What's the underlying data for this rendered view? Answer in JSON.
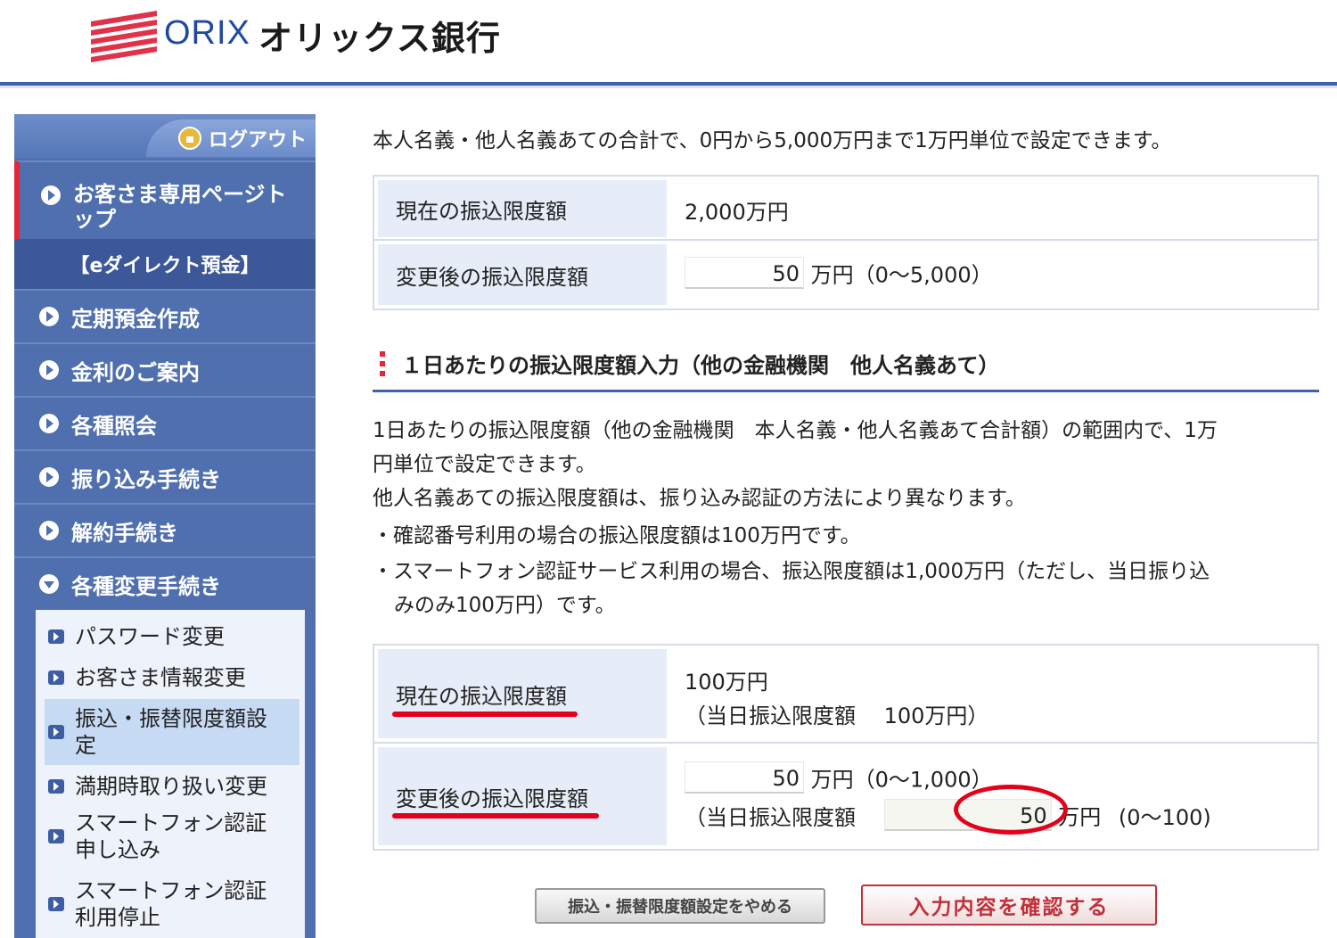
{
  "header": {
    "logo_orix": "ORIX",
    "logo_jp": "オリックス銀行"
  },
  "sidebar": {
    "logout": "ログアウト",
    "top_item": "お客さま専用ページトップ",
    "section_label": "【eダイレクト預金】",
    "items": [
      "定期預金作成",
      "金利のご案内",
      "各種照会",
      "振り込み手続き",
      "解約手続き",
      "各種変更手続き"
    ],
    "sub_items": [
      "パスワード変更",
      "お客さま情報変更",
      "振込・振替限度額設定",
      "満期時取り扱い変更",
      "スマートフォン認証申し込み",
      "スマートフォン認証利用停止"
    ]
  },
  "main": {
    "intro": "本人名義・他人名義あての合計で、0円から5,000万円まで1万円単位で設定できます。",
    "table1": {
      "current_label": "現在の振込限度額",
      "current_value": "2,000万円",
      "new_label": "変更後の振込限度額",
      "new_input": "50",
      "new_unit": "万円（0〜5,000）"
    },
    "section_title": "１日あたりの振込限度額入力（他の金融機関　他人名義あて）",
    "para1_line1": "1日あたりの振込限度額（他の金融機関　本人名義・他人名義あて合計額）の範囲内で、1万",
    "para1_line2": "円単位で設定できます。",
    "para2": "他人名義あての振込限度額は、振り込み認証の方法により異なります。",
    "bullet1": "・確認番号利用の場合の振込限度額は100万円です。",
    "bullet2_line1": "・スマートフォン認証サービス利用の場合、振込限度額は1,000万円（ただし、当日振り込",
    "bullet2_line2": "みのみ100万円）です。",
    "table2": {
      "current_label": "現在の振込限度額",
      "current_value_line1": "100万円",
      "current_value_line2": "（当日振込限度額　 100万円）",
      "new_label": "変更後の振込限度額",
      "new_input": "50",
      "new_unit": "万円（0〜1,000）",
      "sameday_label": "（当日振込限度額",
      "sameday_input": "50",
      "sameday_unit": "万円",
      "sameday_range": "(0〜100)"
    },
    "btn_cancel": "振込・振替限度額設定をやめる",
    "btn_confirm": "入力内容を確認する"
  },
  "colors": {
    "brand_blue": "#3f63a8",
    "sidebar_blue": "#4f6fae",
    "accent_red": "#e3001b"
  }
}
